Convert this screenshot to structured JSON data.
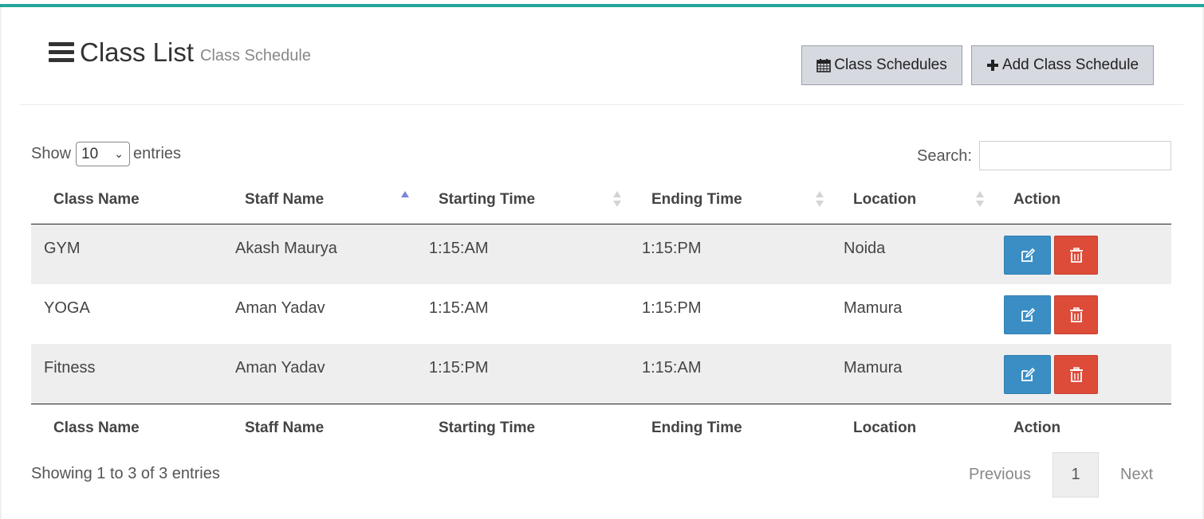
{
  "header": {
    "title": "Class List",
    "subtitle": "Class Schedule",
    "buttons": {
      "class_schedules": "Class Schedules",
      "add_class_schedule": "Add Class Schedule"
    }
  },
  "controls": {
    "show_label": "Show",
    "entries_value": "10",
    "entries_label": "entries",
    "search_label": "Search:",
    "search_value": ""
  },
  "table": {
    "columns": [
      "Class Name",
      "Staff Name",
      "Starting Time",
      "Ending Time",
      "Location",
      "Action"
    ],
    "sorted_column": "Staff Name",
    "sort_direction": "ascending",
    "rows": [
      {
        "class_name": "GYM",
        "staff_name": "Akash Maurya",
        "starting_time": "1:15:AM",
        "ending_time": "1:15:PM",
        "location": "Noida"
      },
      {
        "class_name": "YOGA",
        "staff_name": "Aman Yadav",
        "starting_time": "1:15:AM",
        "ending_time": "1:15:PM",
        "location": "Mamura"
      },
      {
        "class_name": "Fitness",
        "staff_name": "Aman Yadav",
        "starting_time": "1:15:PM",
        "ending_time": "1:15:AM",
        "location": "Mamura"
      }
    ],
    "row_actions": {
      "edit_icon": "edit-icon",
      "delete_icon": "trash-icon"
    }
  },
  "footer": {
    "info": "Showing 1 to 3 of 3 entries",
    "previous": "Previous",
    "current_page": "1",
    "next": "Next"
  },
  "colors": {
    "accent": "#23a69a",
    "edit_button": "#3a8ec4",
    "delete_button": "#dd4b39",
    "sort_active": "#7b86d8"
  }
}
